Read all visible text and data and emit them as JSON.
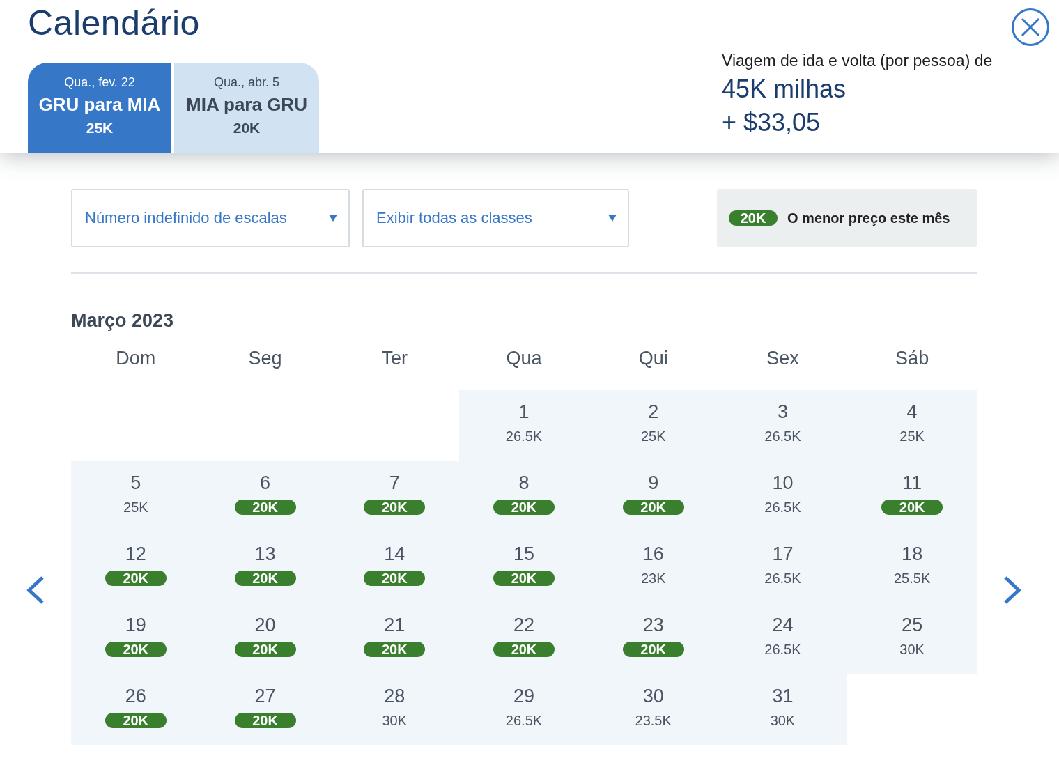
{
  "title": "Calendário",
  "tabs": [
    {
      "date": "Qua., fev. 22",
      "route": "GRU para MIA",
      "price": "25K",
      "selected": true
    },
    {
      "date": "Qua., abr. 5",
      "route": "MIA para GRU",
      "price": "20K",
      "selected": false
    }
  ],
  "summary": {
    "label": "Viagem de ida e volta (por pessoa) de",
    "miles": "45K milhas",
    "cash": "+ $33,05"
  },
  "filters": [
    {
      "value": "Número indefinido de escalas"
    },
    {
      "value": "Exibir todas as classes"
    }
  ],
  "legend": {
    "badge": "20K",
    "text": "O menor preço este mês"
  },
  "month": "Março 2023",
  "weekdays": [
    "Dom",
    "Seg",
    "Ter",
    "Qua",
    "Qui",
    "Sex",
    "Sáb"
  ],
  "weeks": [
    [
      {
        "kind": "blank"
      },
      {
        "kind": "blank"
      },
      {
        "kind": "blank"
      },
      {
        "kind": "day",
        "day": "1",
        "price": "26.5K",
        "lowest": false
      },
      {
        "kind": "day",
        "day": "2",
        "price": "25K",
        "lowest": false
      },
      {
        "kind": "day",
        "day": "3",
        "price": "26.5K",
        "lowest": false
      },
      {
        "kind": "day",
        "day": "4",
        "price": "25K",
        "lowest": false
      }
    ],
    [
      {
        "kind": "day",
        "day": "5",
        "price": "25K",
        "lowest": false
      },
      {
        "kind": "day",
        "day": "6",
        "price": "20K",
        "lowest": true
      },
      {
        "kind": "day",
        "day": "7",
        "price": "20K",
        "lowest": true
      },
      {
        "kind": "day",
        "day": "8",
        "price": "20K",
        "lowest": true
      },
      {
        "kind": "day",
        "day": "9",
        "price": "20K",
        "lowest": true
      },
      {
        "kind": "day",
        "day": "10",
        "price": "26.5K",
        "lowest": false
      },
      {
        "kind": "day",
        "day": "11",
        "price": "20K",
        "lowest": true
      }
    ],
    [
      {
        "kind": "day",
        "day": "12",
        "price": "20K",
        "lowest": true
      },
      {
        "kind": "day",
        "day": "13",
        "price": "20K",
        "lowest": true
      },
      {
        "kind": "day",
        "day": "14",
        "price": "20K",
        "lowest": true
      },
      {
        "kind": "day",
        "day": "15",
        "price": "20K",
        "lowest": true
      },
      {
        "kind": "day",
        "day": "16",
        "price": "23K",
        "lowest": false
      },
      {
        "kind": "day",
        "day": "17",
        "price": "26.5K",
        "lowest": false
      },
      {
        "kind": "day",
        "day": "18",
        "price": "25.5K",
        "lowest": false
      }
    ],
    [
      {
        "kind": "day",
        "day": "19",
        "price": "20K",
        "lowest": true
      },
      {
        "kind": "day",
        "day": "20",
        "price": "20K",
        "lowest": true
      },
      {
        "kind": "day",
        "day": "21",
        "price": "20K",
        "lowest": true
      },
      {
        "kind": "day",
        "day": "22",
        "price": "20K",
        "lowest": true
      },
      {
        "kind": "day",
        "day": "23",
        "price": "20K",
        "lowest": true
      },
      {
        "kind": "day",
        "day": "24",
        "price": "26.5K",
        "lowest": false
      },
      {
        "kind": "day",
        "day": "25",
        "price": "30K",
        "lowest": false
      }
    ],
    [
      {
        "kind": "day",
        "day": "26",
        "price": "20K",
        "lowest": true
      },
      {
        "kind": "day",
        "day": "27",
        "price": "20K",
        "lowest": true
      },
      {
        "kind": "day",
        "day": "28",
        "price": "30K",
        "lowest": false
      },
      {
        "kind": "day",
        "day": "29",
        "price": "26.5K",
        "lowest": false
      },
      {
        "kind": "day",
        "day": "30",
        "price": "23.5K",
        "lowest": false
      },
      {
        "kind": "day",
        "day": "31",
        "price": "30K",
        "lowest": false
      },
      {
        "kind": "blank"
      }
    ]
  ]
}
